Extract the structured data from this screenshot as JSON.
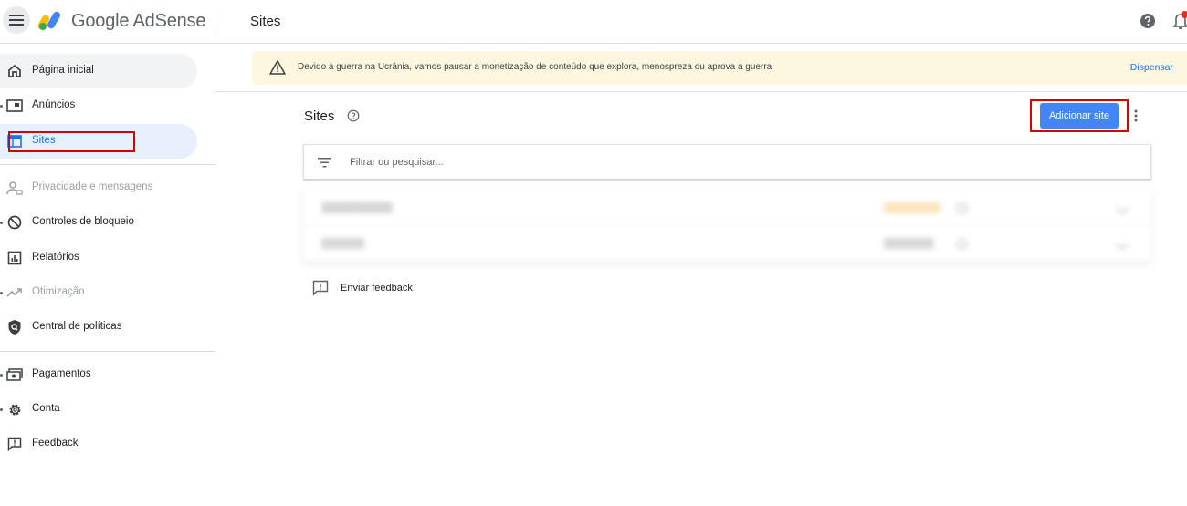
{
  "header": {
    "brand": "Google AdSense",
    "page_title": "Sites"
  },
  "sidebar": {
    "items": [
      {
        "label": "Página inicial",
        "icon": "home-icon",
        "state": "hover"
      },
      {
        "label": "Anúncios",
        "icon": "ads-icon",
        "state": "normal"
      },
      {
        "label": "Sites",
        "icon": "sites-icon",
        "state": "active"
      },
      {
        "label": "Privacidade e mensagens",
        "icon": "privacy-icon",
        "state": "disabled"
      },
      {
        "label": "Controles de bloqueio",
        "icon": "block-icon",
        "state": "normal"
      },
      {
        "label": "Relatórios",
        "icon": "reports-icon",
        "state": "normal"
      },
      {
        "label": "Otimização",
        "icon": "optimization-icon",
        "state": "disabled"
      },
      {
        "label": "Central de políticas",
        "icon": "policy-icon",
        "state": "normal"
      },
      {
        "label": "Pagamentos",
        "icon": "payments-icon",
        "state": "normal"
      },
      {
        "label": "Conta",
        "icon": "gear-icon",
        "state": "normal"
      },
      {
        "label": "Feedback",
        "icon": "feedback-icon",
        "state": "normal"
      }
    ]
  },
  "banner": {
    "text": "Devido à guerra na Ucrânia, vamos pausar a monetização de conteúdo que explora, menospreza ou aprova a guerra",
    "dismiss_label": "Dispensar"
  },
  "main": {
    "title": "Sites",
    "add_button_label": "Adicionar site",
    "filter_placeholder": "Filtrar ou pesquisar...",
    "feedback_label": "Enviar feedback"
  },
  "colors": {
    "accent": "#1a73e8",
    "button": "#4285f4",
    "banner_bg": "#fef7e0",
    "active_nav_bg": "#e8f0fe",
    "highlight_box": "#d50000"
  }
}
